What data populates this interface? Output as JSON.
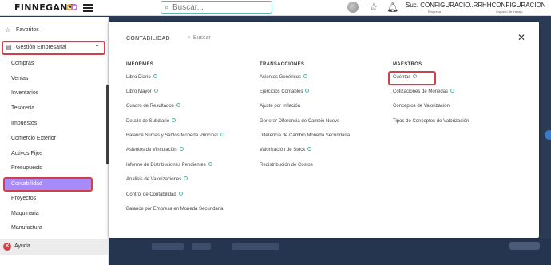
{
  "topbar": {
    "brand": "FINNEGANS",
    "search_placeholder": "Buscar...",
    "empresa_name": "Suc. CONFIGURACIO...",
    "empresa_label": "Empresa",
    "espacio_name": "RRHHCONFIGURACION",
    "espacio_label": "Espacio de trabajo"
  },
  "sidebar": {
    "favoritos": "Favoritos",
    "gestion": "Gestión Empresarial",
    "items": [
      {
        "label": "Compras"
      },
      {
        "label": "Ventas"
      },
      {
        "label": "Inventarios"
      },
      {
        "label": "Tesorería"
      },
      {
        "label": "Impuestos"
      },
      {
        "label": "Comercio Exterior"
      },
      {
        "label": "Activos Fijos"
      },
      {
        "label": "Presupuesto"
      },
      {
        "label": "Contabilidad",
        "active": true
      },
      {
        "label": "Proyectos"
      },
      {
        "label": "Maquinaria"
      },
      {
        "label": "Manufactura"
      }
    ],
    "ayuda": "Ayuda"
  },
  "panel": {
    "title": "CONTABILIDAD",
    "search_placeholder": "Buscar",
    "columns": [
      {
        "header": "INFORMES",
        "links": [
          "Libro Diario",
          "Libro Mayor",
          "Cuadro de Resultados",
          "Detalle de Subdiario",
          "Balance Sumas y Saldos Moneda Principal",
          "Asientos de Vinculación",
          "Informe de Distribuciones Pendientes",
          "Analisis de Valorizaciones",
          "Control de Contabilidad",
          "Balance por Empresa en Moneda Secundaria"
        ]
      },
      {
        "header": "TRANSACCIONES",
        "links": [
          "Asientos Genéricos",
          "Ejercicios Contables",
          "Ajuste por Inflación",
          "Generar Diferencia de Cambio Nuevo",
          "Diferencia de Cambio Moneda Secundaria",
          "Valorización de Stock",
          "Redistribución de Costos"
        ]
      },
      {
        "header": "MAESTROS",
        "links": [
          "Cuentas",
          "Cotizaciones de Monedas",
          "Conceptos de Valorización",
          "Tipos de Conceptos de Valorización"
        ]
      }
    ]
  },
  "colors": {
    "accent_teal": "#5ab5b2",
    "active_purple": "#a78bfa",
    "highlight_red": "#d0404a",
    "backdrop": "#2b3a55"
  }
}
